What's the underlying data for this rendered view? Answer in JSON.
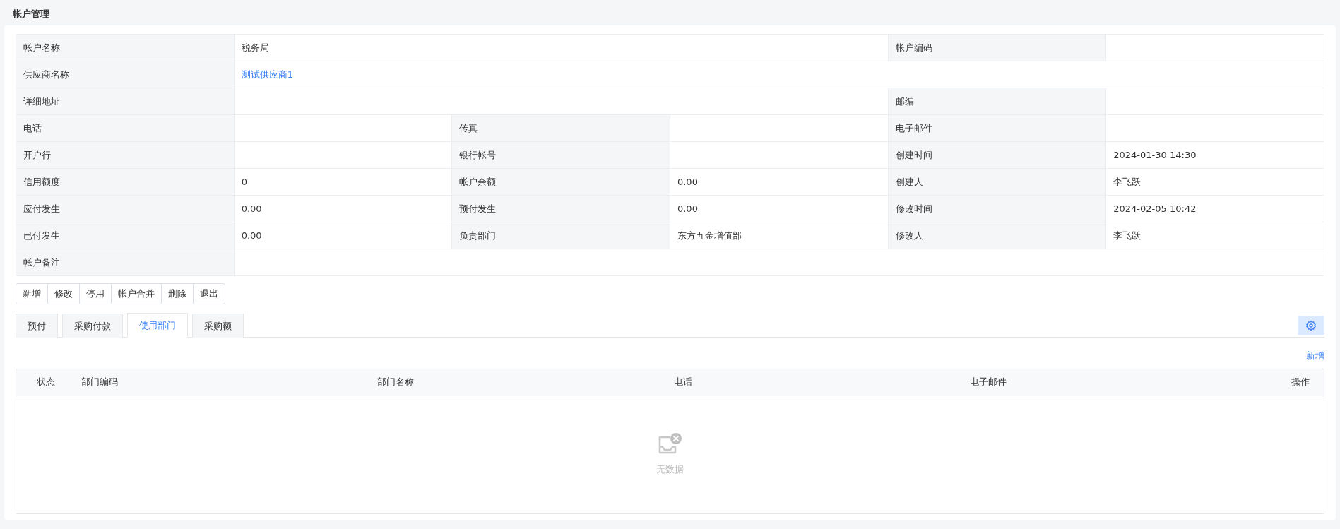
{
  "page": {
    "title": "帐户管理"
  },
  "details": [
    {
      "fields": [
        {
          "label": "帐户名称",
          "value": "税务局"
        },
        {
          "label": "帐户编码"
        }
      ]
    },
    {
      "fields": [
        {
          "label": "供应商名称",
          "value": "测试供应商1",
          "kind": "link"
        }
      ]
    },
    {
      "fields": [
        {
          "label": "详细地址"
        },
        {
          "label": "邮编"
        }
      ]
    },
    {
      "fields": [
        {
          "label": "电话"
        },
        {
          "label": "传真"
        },
        {
          "label": "电子邮件"
        }
      ]
    },
    {
      "fields": [
        {
          "label": "开户行"
        },
        {
          "label": "银行帐号"
        },
        {
          "label": "创建时间",
          "value": "2024-01-30 14:30"
        }
      ]
    },
    {
      "fields": [
        {
          "label": "信用额度",
          "value": "0"
        },
        {
          "label": "帐户余额",
          "value": "0.00"
        },
        {
          "label": "创建人",
          "value": "李飞跃"
        }
      ]
    },
    {
      "fields": [
        {
          "label": "应付发生",
          "value": "0.00"
        },
        {
          "label": "预付发生",
          "value": "0.00"
        },
        {
          "label": "修改时间",
          "value": "2024-02-05 10:42"
        }
      ]
    },
    {
      "fields": [
        {
          "label": "已付发生",
          "value": "0.00"
        },
        {
          "label": "负责部门",
          "value": "东方五金增值部"
        },
        {
          "label": "修改人",
          "value": "李飞跃"
        }
      ]
    },
    {
      "fields": [
        {
          "label": "帐户备注"
        }
      ]
    }
  ],
  "toolbar": [
    "新增",
    "修改",
    "停用",
    "帐户合并",
    "删除",
    "退出"
  ],
  "tabs": [
    {
      "label": "预付",
      "selected": false
    },
    {
      "label": "采购付款",
      "selected": false
    },
    {
      "label": "使用部门",
      "selected": true
    },
    {
      "label": "采购额",
      "selected": false
    }
  ],
  "add_link": "新增",
  "table": {
    "columns": [
      "状态",
      "部门编码",
      "部门名称",
      "电话",
      "电子邮件",
      "操作"
    ],
    "empty_text": "无数据"
  }
}
